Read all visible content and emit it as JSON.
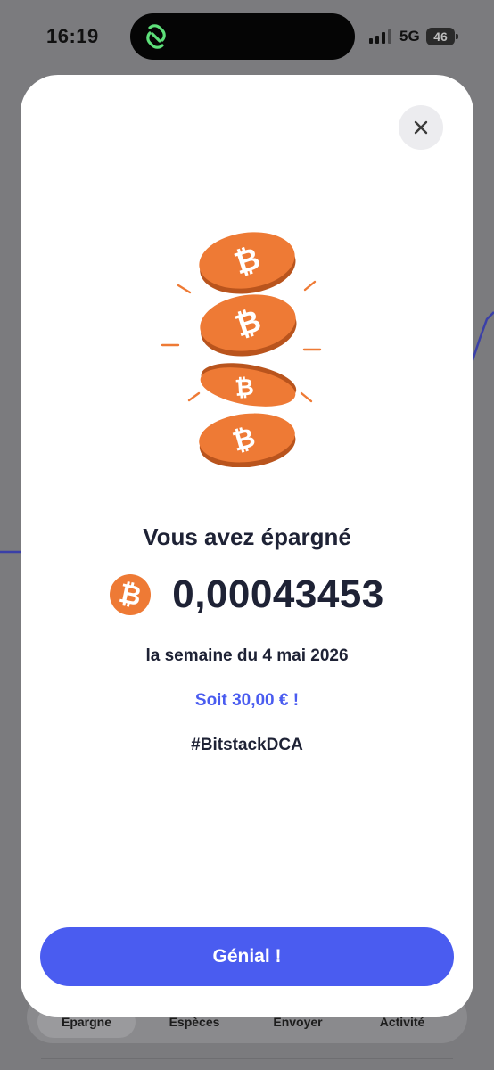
{
  "status_bar": {
    "time": "16:19",
    "network": "5G",
    "battery": "46"
  },
  "background_tabs": [
    {
      "label": "Épargne"
    },
    {
      "label": "Espèces"
    },
    {
      "label": "Envoyer"
    },
    {
      "label": "Activité"
    }
  ],
  "modal": {
    "title": "Vous avez épargné",
    "amount": "0,00043453",
    "period": "la semaine du 4 mai 2026",
    "equivalent": "Soit 30,00 € !",
    "hashtag": "#BitstackDCA",
    "cta_label": "Génial !",
    "icons": {
      "close": "close-icon",
      "currency": "bitcoin-icon",
      "illustration": "falling-bitcoin-coins-illustration"
    }
  },
  "colors": {
    "accent": "#4a5cf0",
    "bitcoin_orange": "#ee7a35",
    "text_dark": "#1e2235",
    "overlay": "#7b7b7e"
  }
}
